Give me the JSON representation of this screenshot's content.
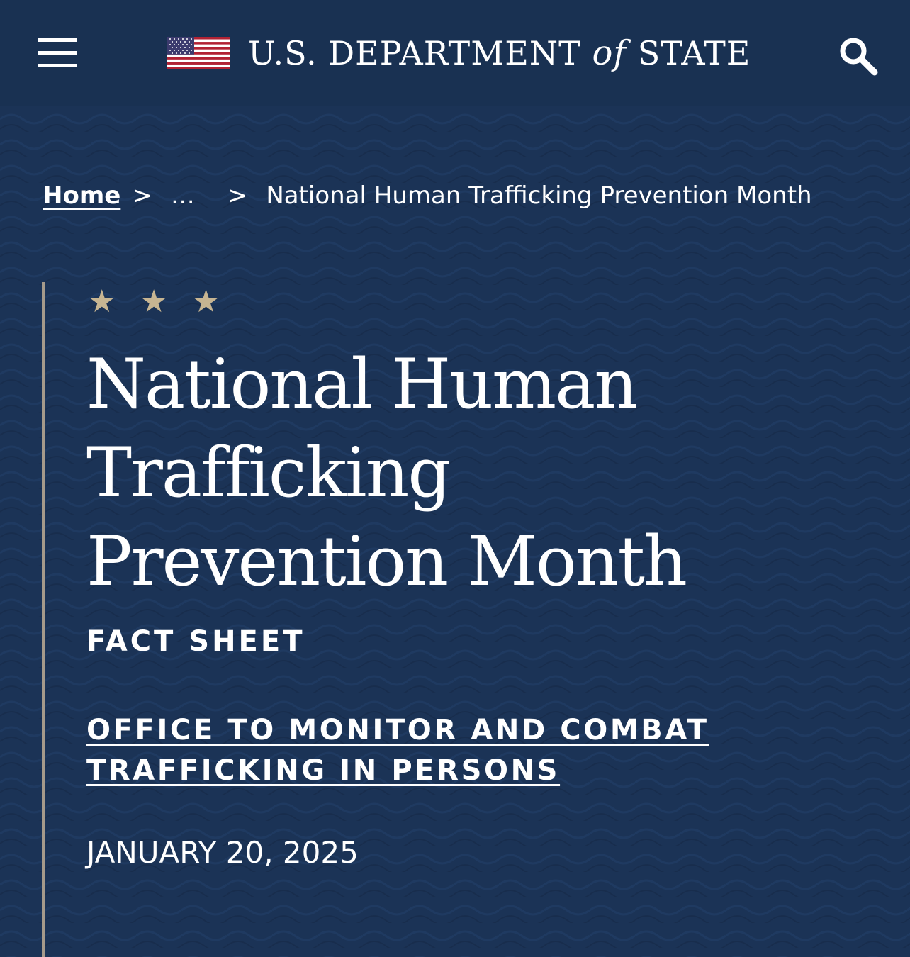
{
  "header": {
    "site_title_prefix": "U.S. DEPARTMENT",
    "site_title_of": "of",
    "site_title_suffix": "STATE",
    "menu_icon": "hamburger-menu-icon",
    "flag_icon": "us-flag-icon",
    "search_icon": "search-icon"
  },
  "breadcrumb": {
    "home": "Home",
    "separator": ">",
    "ellipsis": "…",
    "current": "National Human Trafficking Prevention Month"
  },
  "article": {
    "stars": "★ ★ ★",
    "title": "National Human Trafficking Prevention Month",
    "type": "FACT SHEET",
    "office": "OFFICE TO MONITOR AND COMBAT TRAFFICKING IN PERSONS",
    "date": "JANUARY 20, 2025"
  },
  "colors": {
    "background": "#1a2f4f",
    "header": "#193152",
    "accent_gold": "#c7b592",
    "rule": "#a59a8b",
    "text": "#ffffff"
  }
}
